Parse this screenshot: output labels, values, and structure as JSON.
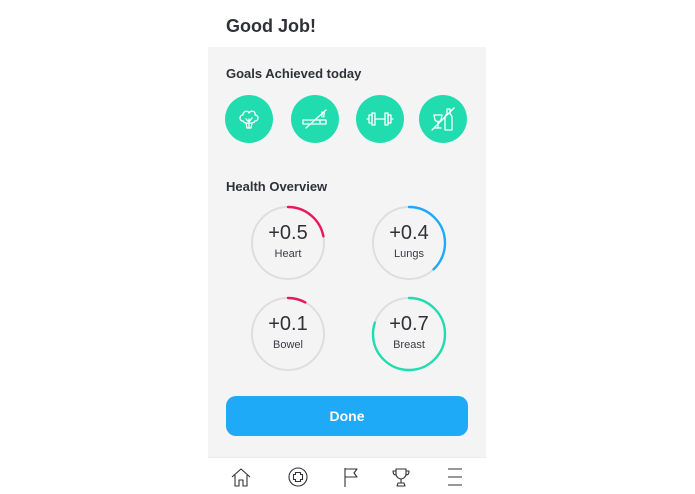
{
  "header": {
    "title": "Good Job!"
  },
  "goals": {
    "title": "Goals Achieved today",
    "items": [
      {
        "icon": "broccoli-icon"
      },
      {
        "icon": "no-smoking-icon"
      },
      {
        "icon": "dumbbell-icon"
      },
      {
        "icon": "no-alcohol-icon"
      }
    ],
    "color": "#20dcae"
  },
  "health": {
    "title": "Health Overview",
    "metrics": [
      {
        "value": "+0.5",
        "label": "Heart",
        "progress": 0.22,
        "color": "#e8185e"
      },
      {
        "value": "+0.4",
        "label": "Lungs",
        "progress": 0.38,
        "color": "#1eaaf6"
      },
      {
        "value": "+0.1",
        "label": "Bowel",
        "progress": 0.08,
        "color": "#e8185e"
      },
      {
        "value": "+0.7",
        "label": "Breast",
        "progress": 0.8,
        "color": "#20dcae"
      }
    ],
    "track_color": "#dedede"
  },
  "actions": {
    "done_label": "Done",
    "done_color": "#1eaaf6"
  },
  "tabbar": {
    "items": [
      {
        "icon": "home-icon"
      },
      {
        "icon": "add-circle-icon"
      },
      {
        "icon": "flag-icon"
      },
      {
        "icon": "trophy-icon"
      },
      {
        "icon": "menu-icon"
      }
    ]
  }
}
